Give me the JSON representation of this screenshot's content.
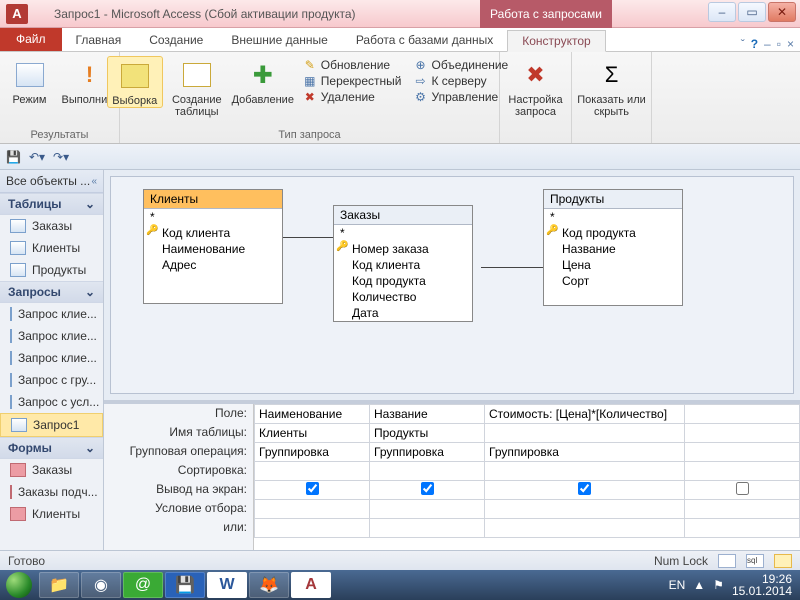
{
  "title": "Запрос1 - Microsoft Access (Сбой активации продукта)",
  "context_title": "Работа с запросами",
  "tabs": {
    "file": "Файл",
    "home": "Главная",
    "create": "Создание",
    "ext": "Внешние данные",
    "db": "Работа с базами данных",
    "ctx": "Конструктор"
  },
  "ribbon": {
    "results": {
      "mode": "Режим",
      "run": "Выполнить",
      "label": "Результаты"
    },
    "qtype": {
      "select": "Выборка",
      "maketable": "Создание таблицы",
      "append": "Добавление",
      "update": "Обновление",
      "crosstab": "Перекрестный",
      "delete": "Удаление",
      "union": "Объединение",
      "passthrough": "К серверу",
      "datadef": "Управление",
      "label": "Тип запроса"
    },
    "setup": {
      "label": "Настройка запроса"
    },
    "show": {
      "totals": "Показать или скрыть"
    }
  },
  "nav": {
    "header": "Все объекты ...",
    "sections": {
      "tables": {
        "label": "Таблицы",
        "items": [
          "Заказы",
          "Клиенты",
          "Продукты"
        ]
      },
      "queries": {
        "label": "Запросы",
        "items": [
          "Запрос клие...",
          "Запрос клие...",
          "Запрос клие...",
          "Запрос с гру...",
          "Запрос с усл...",
          "Запрос1"
        ]
      },
      "forms": {
        "label": "Формы",
        "items": [
          "Заказы",
          "Заказы подч...",
          "Клиенты"
        ]
      }
    }
  },
  "diagram": {
    "t1": {
      "title": "Клиенты",
      "fields": [
        "Код клиента",
        "Наименование",
        "Адрес"
      ]
    },
    "t2": {
      "title": "Заказы",
      "fields": [
        "Номер заказа",
        "Код клиента",
        "Код продукта",
        "Количество",
        "Дата"
      ]
    },
    "t3": {
      "title": "Продукты",
      "fields": [
        "Код продукта",
        "Название",
        "Цена",
        "Сорт"
      ]
    }
  },
  "grid": {
    "labels": [
      "Поле:",
      "Имя таблицы:",
      "Групповая операция:",
      "Сортировка:",
      "Вывод на экран:",
      "Условие отбора:",
      "или:"
    ],
    "cols": [
      {
        "field": "Наименование",
        "table": "Клиенты",
        "group": "Группировка",
        "show": true
      },
      {
        "field": "Название",
        "table": "Продукты",
        "group": "Группировка",
        "show": true
      },
      {
        "field": "Стоимость: [Цена]*[Количество]",
        "table": "",
        "group": "Группировка",
        "show": true
      },
      {
        "field": "",
        "table": "",
        "group": "",
        "show": false
      }
    ]
  },
  "status": {
    "ready": "Готово",
    "numlock": "Num Lock"
  },
  "tray": {
    "lang": "EN",
    "time": "19:26",
    "date": "15.01.2014"
  },
  "sigma": "Σ"
}
